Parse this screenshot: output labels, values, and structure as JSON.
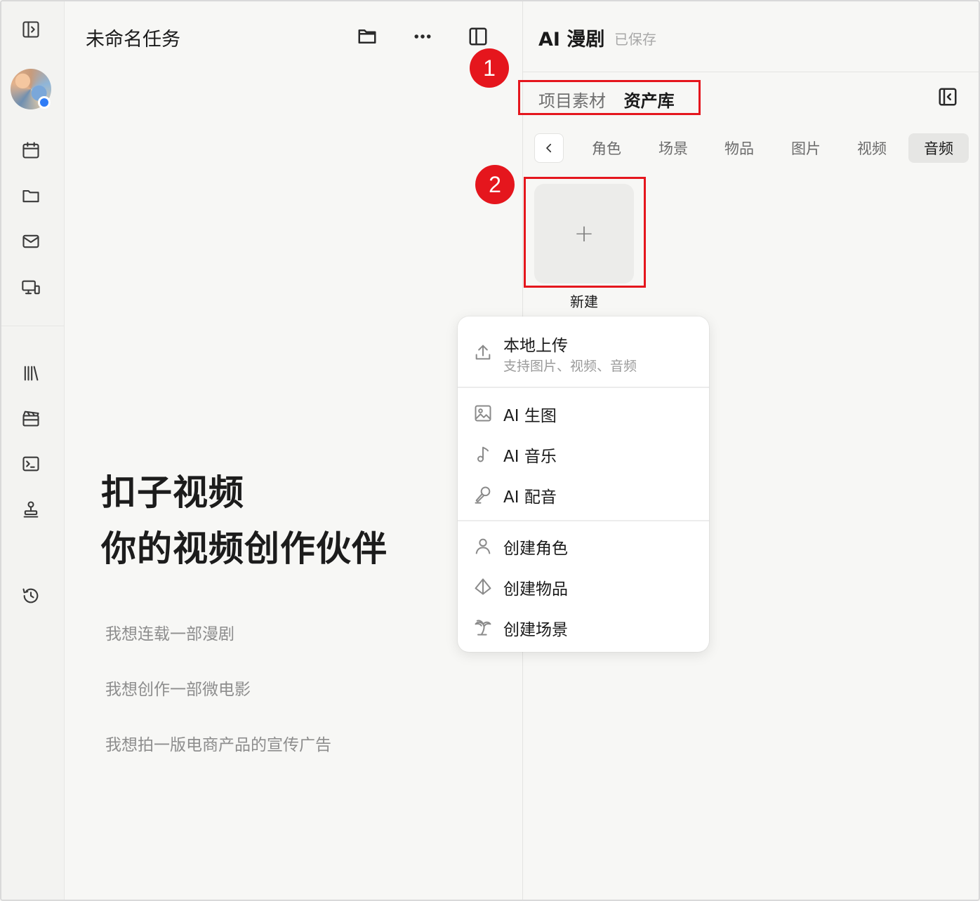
{
  "task": {
    "title": "未命名任务"
  },
  "hero": {
    "line1": "扣子视频",
    "line2": "你的视频创作伙伴"
  },
  "suggestions": [
    "我想连载一部漫剧",
    "我想创作一部微电影",
    "我想拍一版电商产品的宣传广告"
  ],
  "panel": {
    "title": "AI 漫剧",
    "status": "已保存",
    "library_tabs": [
      "项目素材",
      "资产库"
    ],
    "category_tabs": [
      "角色",
      "场景",
      "物品",
      "图片",
      "视频",
      "音频"
    ],
    "active_category": "音频",
    "new_card_label": "新建",
    "new_card_symbol": "+"
  },
  "annotations": [
    "1",
    "2"
  ],
  "menu": {
    "upload_title": "本地上传",
    "upload_sub": "支持图片、视频、音频",
    "ai_image": "AI 生图",
    "ai_music": "AI 音乐",
    "ai_voice": "AI 配音",
    "create_character": "创建角色",
    "create_item": "创建物品",
    "create_scene": "创建场景"
  },
  "colors": {
    "annotation": "#e5161d",
    "status_dot": "#2f7cf6",
    "background": "#f7f7f5"
  },
  "icons": {
    "rail": [
      "sidebar-toggle-icon",
      "calendar-icon",
      "folder-icon",
      "mail-icon",
      "devices-icon",
      "library-icon",
      "clapperboard-icon",
      "terminal-icon",
      "stamp-icon",
      "history-icon"
    ],
    "top": [
      "folder-open-icon",
      "more-icon",
      "panel-icon"
    ]
  }
}
